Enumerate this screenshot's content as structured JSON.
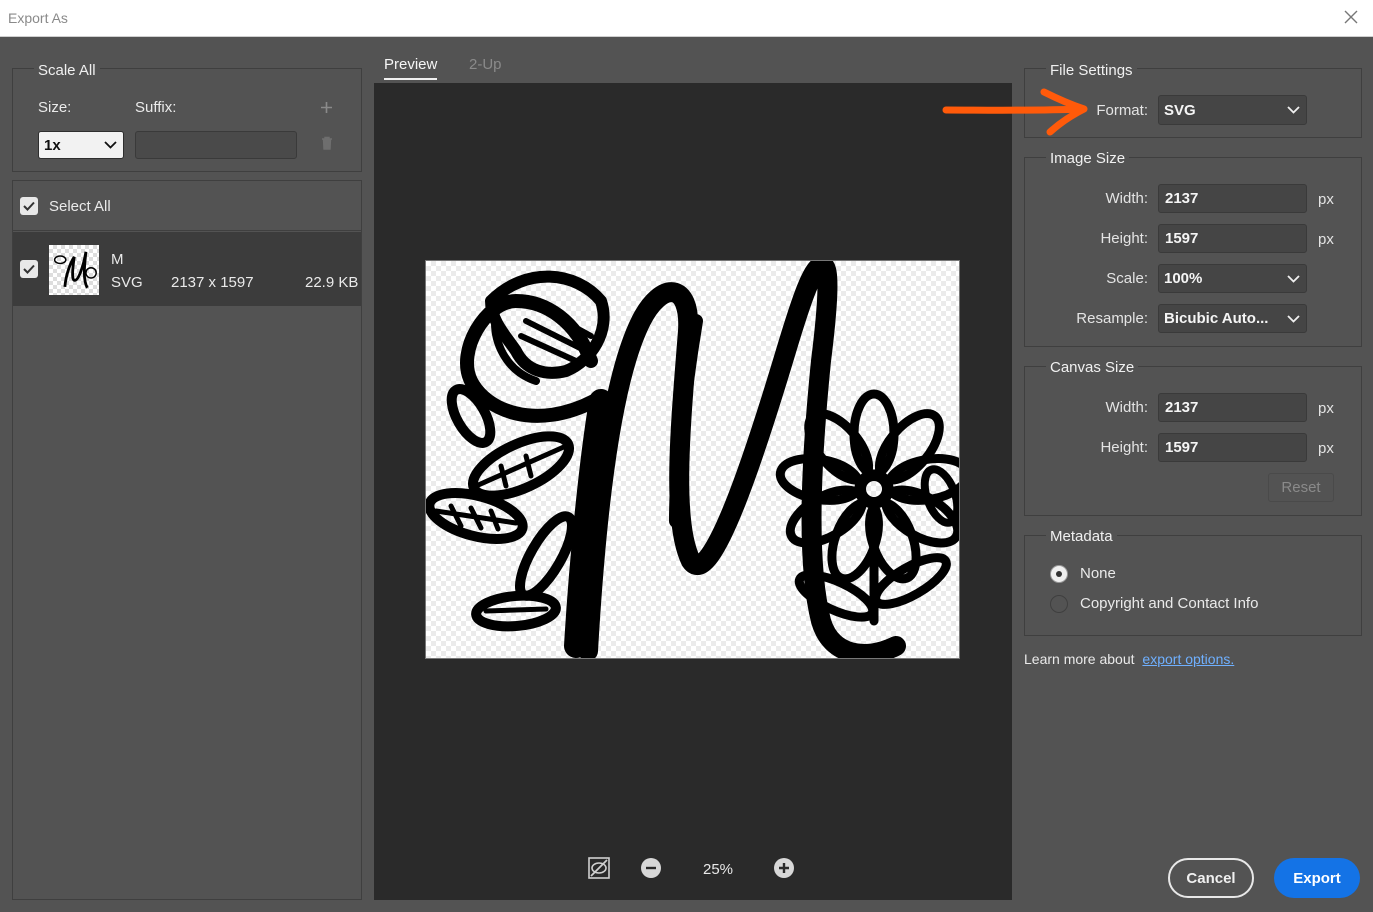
{
  "window": {
    "title": "Export As"
  },
  "scale_all": {
    "title": "Scale All",
    "size_label": "Size:",
    "suffix_label": "Suffix:",
    "size_value": "1x",
    "suffix_value": "",
    "add_icon": "plus-icon",
    "delete_icon": "trash-icon"
  },
  "assets": {
    "select_all_label": "Select All",
    "select_all_checked": true,
    "items": [
      {
        "name": "M",
        "format": "SVG",
        "dimensions": "2137 x 1597",
        "size": "22.9 KB",
        "checked": true
      }
    ]
  },
  "preview": {
    "tabs": [
      {
        "label": "Preview",
        "active": true
      },
      {
        "label": "2-Up",
        "active": false
      }
    ],
    "zoom": "25%",
    "zoom_out_icon": "minus-circle-icon",
    "zoom_in_icon": "plus-circle-icon",
    "toggle_icon": "hide-preview-icon"
  },
  "file_settings": {
    "title": "File Settings",
    "format_label": "Format:",
    "format_value": "SVG"
  },
  "image_size": {
    "title": "Image Size",
    "width_label": "Width:",
    "width_value": "2137",
    "height_label": "Height:",
    "height_value": "1597",
    "scale_label": "Scale:",
    "scale_value": "100%",
    "resample_label": "Resample:",
    "resample_value": "Bicubic Auto...",
    "unit": "px"
  },
  "canvas_size": {
    "title": "Canvas Size",
    "width_label": "Width:",
    "width_value": "2137",
    "height_label": "Height:",
    "height_value": "1597",
    "unit": "px",
    "reset_label": "Reset"
  },
  "metadata": {
    "title": "Metadata",
    "options": [
      {
        "label": "None",
        "selected": true
      },
      {
        "label": "Copyright and Contact Info",
        "selected": false
      }
    ]
  },
  "learn_more": {
    "text": "Learn more about",
    "link": "export options."
  },
  "buttons": {
    "cancel": "Cancel",
    "export": "Export"
  },
  "colors": {
    "accent": "#1473e6",
    "annotation_arrow": "#ff5a0a",
    "panel_bg": "#535353",
    "preview_bg": "#2a2a2a"
  }
}
